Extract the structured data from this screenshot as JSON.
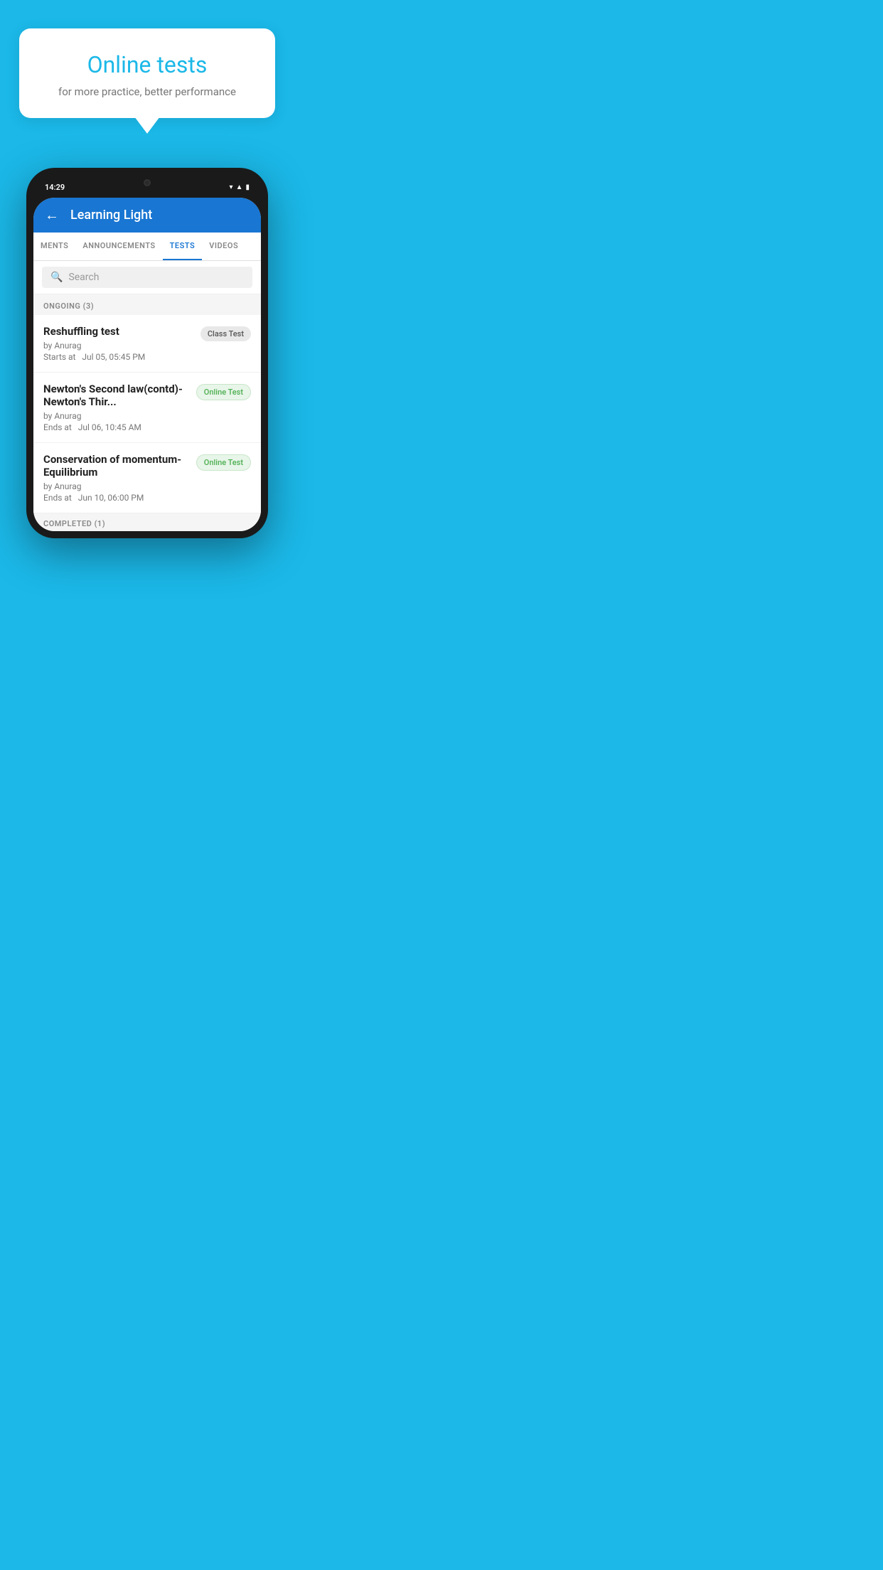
{
  "background_color": "#1BB8E8",
  "bubble": {
    "title": "Online tests",
    "subtitle": "for more practice, better performance"
  },
  "phone": {
    "status_bar": {
      "time": "14:29",
      "icons": [
        "wifi",
        "signal",
        "battery"
      ]
    },
    "header": {
      "title": "Learning Light",
      "back_label": "←"
    },
    "tabs": [
      {
        "label": "MENTS",
        "active": false
      },
      {
        "label": "ANNOUNCEMENTS",
        "active": false
      },
      {
        "label": "TESTS",
        "active": true
      },
      {
        "label": "VIDEOS",
        "active": false
      }
    ],
    "search": {
      "placeholder": "Search"
    },
    "sections": [
      {
        "heading": "ONGOING (3)",
        "tests": [
          {
            "name": "Reshuffling test",
            "author": "by Anurag",
            "date_label": "Starts at",
            "date": "Jul 05, 05:45 PM",
            "badge": "Class Test",
            "badge_type": "class"
          },
          {
            "name": "Newton's Second law(contd)-Newton's Thir...",
            "author": "by Anurag",
            "date_label": "Ends at",
            "date": "Jul 06, 10:45 AM",
            "badge": "Online Test",
            "badge_type": "online"
          },
          {
            "name": "Conservation of momentum-Equilibrium",
            "author": "by Anurag",
            "date_label": "Ends at",
            "date": "Jun 10, 06:00 PM",
            "badge": "Online Test",
            "badge_type": "online"
          }
        ]
      }
    ],
    "completed_heading": "COMPLETED (1)"
  }
}
